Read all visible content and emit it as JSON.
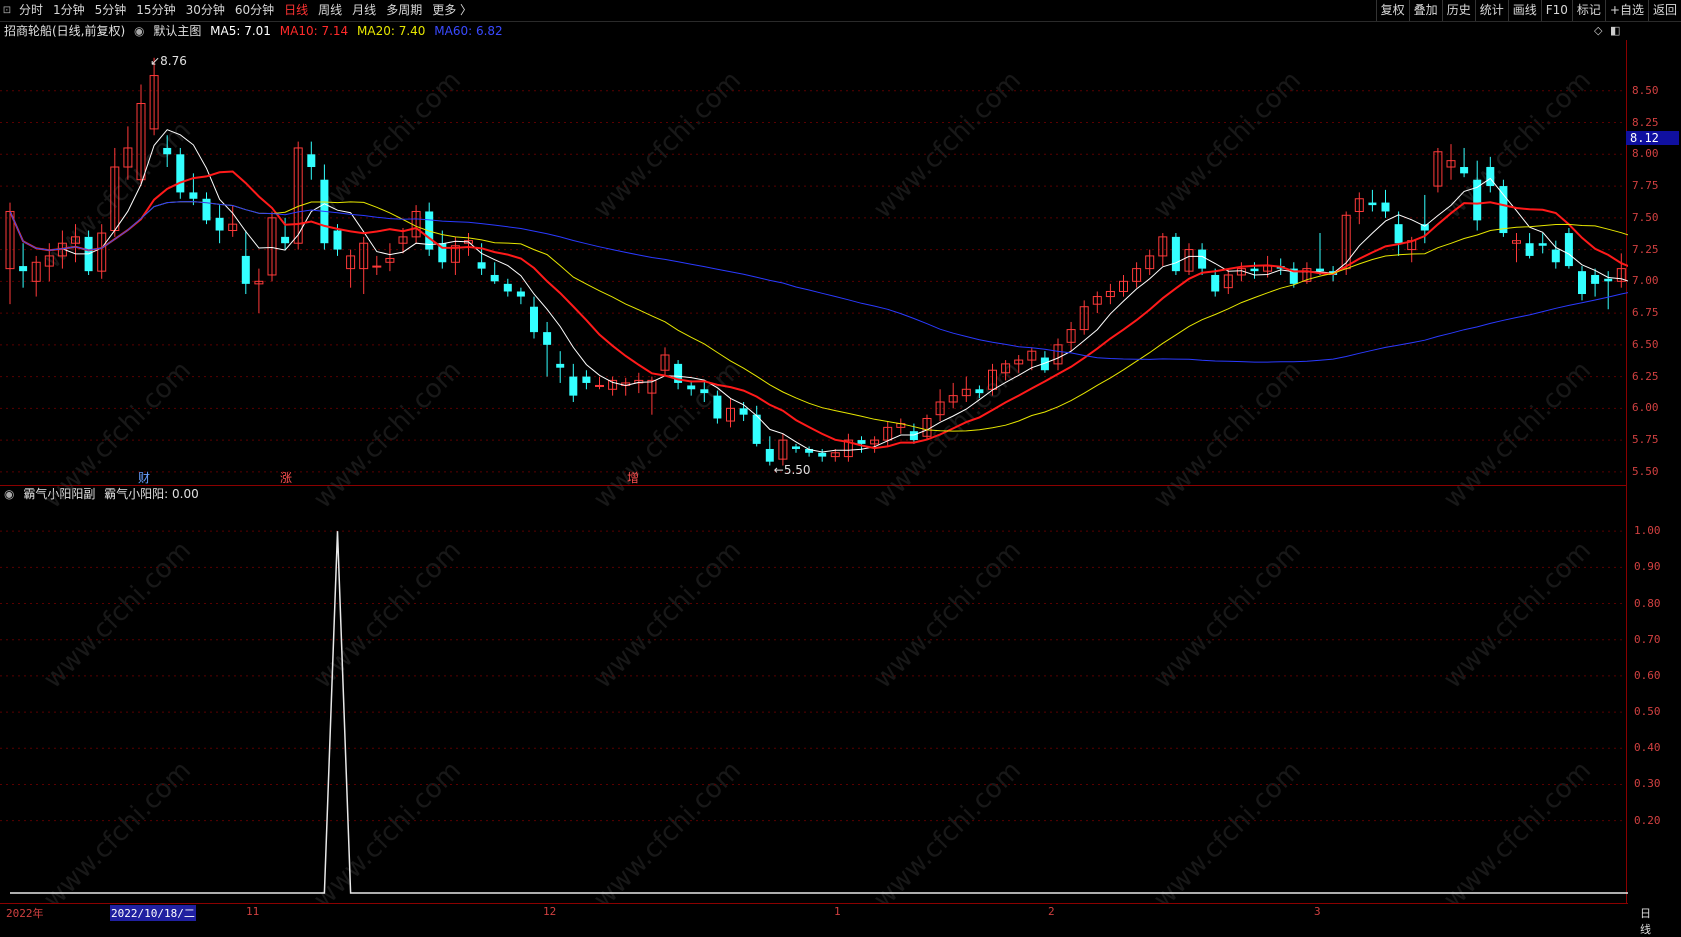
{
  "toolbar": {
    "left_items": [
      "分时",
      "1分钟",
      "5分钟",
      "15分钟",
      "30分钟",
      "60分钟",
      "日线",
      "周线",
      "月线",
      "多周期",
      "更多 〉"
    ],
    "active_item": "日线",
    "right_items": [
      "复权",
      "叠加",
      "历史",
      "统计",
      "画线",
      "F10",
      "标记",
      "+自选",
      "返回"
    ]
  },
  "main_info": {
    "stock": "招商轮船(日线,前复权)",
    "template": "默认主图",
    "ma5": "MA5: 7.01",
    "ma10": "MA10: 7.14",
    "ma20": "MA20: 7.40",
    "ma60": "MA60: 6.82"
  },
  "sub_info": {
    "indicator": "霸气小阳阳副",
    "value": "霸气小阳阳: 0.00"
  },
  "colors": {
    "up": "#ff3a3a",
    "down": "#33ffff",
    "ma5": "#ffffff",
    "ma10": "#ff1a1a",
    "ma20": "#e6e600",
    "ma60": "#2a3aff",
    "border": "#8b0000"
  },
  "price_axis": [
    "8.50",
    "8.25",
    "8.00",
    "7.75",
    "7.50",
    "7.25",
    "7.00",
    "6.75",
    "6.50",
    "6.25",
    "6.00",
    "5.75",
    "5.50"
  ],
  "current_price": "8.12",
  "annotations": {
    "high": "8.76",
    "low": "←5.50",
    "high_arrow": "↙"
  },
  "events": [
    {
      "label": "财",
      "color": "#6aa0ff"
    },
    {
      "label": "涨",
      "color": "#ff5050"
    },
    {
      "label": "增",
      "color": "#ff5050"
    }
  ],
  "sub_axis": [
    "1.00",
    "0.90",
    "0.80",
    "0.70",
    "0.60",
    "0.50",
    "0.40",
    "0.30",
    "0.20"
  ],
  "date_axis": {
    "labels": [
      "2022年",
      "11",
      "12",
      "1",
      "2",
      "3"
    ],
    "selected": "2022/10/18/二",
    "period": "日线"
  },
  "watermark": "www.cfchi.com",
  "chart_data": {
    "type": "candlestick",
    "title": "招商轮船(日线,前复权)",
    "ylim": [
      5.42,
      8.9
    ],
    "candles": [
      [
        7.1,
        7.62,
        6.82,
        7.55
      ],
      [
        7.12,
        7.3,
        6.95,
        7.08
      ],
      [
        7.0,
        7.2,
        6.88,
        7.15
      ],
      [
        7.12,
        7.3,
        7.0,
        7.2
      ],
      [
        7.2,
        7.4,
        7.1,
        7.3
      ],
      [
        7.3,
        7.45,
        7.15,
        7.35
      ],
      [
        7.35,
        7.4,
        7.05,
        7.08
      ],
      [
        7.08,
        7.45,
        7.02,
        7.38
      ],
      [
        7.4,
        8.05,
        7.35,
        7.9
      ],
      [
        7.9,
        8.22,
        7.8,
        8.05
      ],
      [
        7.8,
        8.55,
        7.75,
        8.4
      ],
      [
        8.2,
        8.76,
        8.15,
        8.62
      ],
      [
        8.05,
        8.15,
        7.9,
        8.0
      ],
      [
        8.0,
        8.05,
        7.65,
        7.7
      ],
      [
        7.7,
        7.85,
        7.6,
        7.65
      ],
      [
        7.65,
        7.7,
        7.45,
        7.48
      ],
      [
        7.5,
        7.6,
        7.3,
        7.4
      ],
      [
        7.4,
        7.6,
        7.35,
        7.45
      ],
      [
        7.2,
        7.4,
        6.9,
        6.98
      ],
      [
        6.98,
        7.1,
        6.75,
        7.0
      ],
      [
        7.05,
        7.55,
        7.0,
        7.5
      ],
      [
        7.35,
        7.5,
        7.25,
        7.3
      ],
      [
        7.3,
        8.1,
        7.25,
        8.05
      ],
      [
        8.0,
        8.1,
        7.8,
        7.9
      ],
      [
        7.8,
        7.92,
        7.25,
        7.3
      ],
      [
        7.4,
        7.45,
        7.2,
        7.25
      ],
      [
        7.1,
        7.25,
        6.95,
        7.2
      ],
      [
        7.1,
        7.35,
        6.9,
        7.3
      ],
      [
        7.12,
        7.2,
        7.05,
        7.12
      ],
      [
        7.15,
        7.3,
        7.08,
        7.18
      ],
      [
        7.3,
        7.42,
        7.22,
        7.35
      ],
      [
        7.35,
        7.6,
        7.3,
        7.55
      ],
      [
        7.55,
        7.62,
        7.2,
        7.25
      ],
      [
        7.3,
        7.4,
        7.1,
        7.15
      ],
      [
        7.15,
        7.35,
        7.05,
        7.28
      ],
      [
        7.3,
        7.38,
        7.2,
        7.32
      ],
      [
        7.15,
        7.3,
        7.05,
        7.1
      ],
      [
        7.05,
        7.15,
        6.98,
        7.0
      ],
      [
        6.98,
        7.02,
        6.88,
        6.92
      ],
      [
        6.92,
        6.95,
        6.82,
        6.88
      ],
      [
        6.8,
        6.88,
        6.55,
        6.6
      ],
      [
        6.6,
        6.68,
        6.25,
        6.5
      ],
      [
        6.35,
        6.45,
        6.2,
        6.32
      ],
      [
        6.25,
        6.35,
        6.05,
        6.1
      ],
      [
        6.25,
        6.3,
        6.15,
        6.2
      ],
      [
        6.18,
        6.25,
        6.15,
        6.18
      ],
      [
        6.15,
        6.25,
        6.1,
        6.22
      ],
      [
        6.18,
        6.24,
        6.1,
        6.2
      ],
      [
        6.2,
        6.28,
        6.12,
        6.22
      ],
      [
        6.12,
        6.25,
        5.95,
        6.22
      ],
      [
        6.3,
        6.48,
        6.25,
        6.42
      ],
      [
        6.35,
        6.38,
        6.15,
        6.2
      ],
      [
        6.18,
        6.22,
        6.1,
        6.15
      ],
      [
        6.15,
        6.22,
        6.05,
        6.12
      ],
      [
        6.1,
        6.14,
        5.88,
        5.92
      ],
      [
        5.9,
        6.08,
        5.85,
        6.0
      ],
      [
        6.0,
        6.05,
        5.9,
        5.95
      ],
      [
        5.95,
        6.02,
        5.7,
        5.72
      ],
      [
        5.68,
        5.78,
        5.55,
        5.58
      ],
      [
        5.6,
        5.8,
        5.55,
        5.75
      ],
      [
        5.7,
        5.72,
        5.65,
        5.68
      ],
      [
        5.68,
        5.7,
        5.62,
        5.65
      ],
      [
        5.65,
        5.68,
        5.58,
        5.62
      ],
      [
        5.62,
        5.68,
        5.58,
        5.65
      ],
      [
        5.62,
        5.8,
        5.58,
        5.75
      ],
      [
        5.75,
        5.78,
        5.65,
        5.72
      ],
      [
        5.72,
        5.78,
        5.65,
        5.75
      ],
      [
        5.75,
        5.9,
        5.7,
        5.85
      ],
      [
        5.85,
        5.92,
        5.8,
        5.88
      ],
      [
        5.82,
        5.88,
        5.72,
        5.75
      ],
      [
        5.78,
        5.95,
        5.75,
        5.92
      ],
      [
        5.95,
        6.15,
        5.9,
        6.05
      ],
      [
        6.05,
        6.2,
        6.0,
        6.1
      ],
      [
        6.1,
        6.25,
        6.05,
        6.15
      ],
      [
        6.15,
        6.18,
        6.08,
        6.12
      ],
      [
        6.15,
        6.35,
        6.1,
        6.3
      ],
      [
        6.28,
        6.38,
        6.22,
        6.35
      ],
      [
        6.35,
        6.42,
        6.28,
        6.38
      ],
      [
        6.38,
        6.48,
        6.3,
        6.45
      ],
      [
        6.4,
        6.45,
        6.28,
        6.3
      ],
      [
        6.35,
        6.55,
        6.3,
        6.5
      ],
      [
        6.52,
        6.68,
        6.45,
        6.62
      ],
      [
        6.62,
        6.85,
        6.58,
        6.8
      ],
      [
        6.82,
        6.92,
        6.75,
        6.88
      ],
      [
        6.88,
        6.98,
        6.82,
        6.92
      ],
      [
        6.92,
        7.05,
        6.88,
        7.0
      ],
      [
        7.0,
        7.15,
        6.95,
        7.1
      ],
      [
        7.1,
        7.25,
        7.05,
        7.2
      ],
      [
        7.2,
        7.38,
        7.12,
        7.35
      ],
      [
        7.35,
        7.38,
        7.05,
        7.08
      ],
      [
        7.08,
        7.3,
        7.05,
        7.25
      ],
      [
        7.25,
        7.3,
        7.05,
        7.1
      ],
      [
        7.05,
        7.1,
        6.88,
        6.92
      ],
      [
        6.95,
        7.1,
        6.9,
        7.05
      ],
      [
        7.05,
        7.15,
        7.0,
        7.1
      ],
      [
        7.1,
        7.15,
        7.02,
        7.08
      ],
      [
        7.08,
        7.2,
        7.03,
        7.12
      ],
      [
        7.12,
        7.18,
        7.05,
        7.1
      ],
      [
        7.1,
        7.15,
        6.95,
        6.98
      ],
      [
        7.0,
        7.15,
        6.98,
        7.1
      ],
      [
        7.1,
        7.38,
        7.05,
        7.08
      ],
      [
        7.08,
        7.12,
        7.0,
        7.05
      ],
      [
        7.1,
        7.55,
        7.05,
        7.52
      ],
      [
        7.55,
        7.7,
        7.45,
        7.65
      ],
      [
        7.62,
        7.72,
        7.55,
        7.6
      ],
      [
        7.62,
        7.72,
        7.5,
        7.55
      ],
      [
        7.45,
        7.55,
        7.2,
        7.3
      ],
      [
        7.25,
        7.35,
        7.15,
        7.32
      ],
      [
        7.45,
        7.68,
        7.3,
        7.4
      ],
      [
        7.75,
        8.05,
        7.7,
        8.02
      ],
      [
        7.9,
        8.08,
        7.8,
        7.95
      ],
      [
        7.9,
        8.05,
        7.82,
        7.85
      ],
      [
        7.8,
        7.95,
        7.4,
        7.48
      ],
      [
        7.9,
        7.98,
        7.7,
        7.75
      ],
      [
        7.75,
        7.8,
        7.35,
        7.38
      ],
      [
        7.3,
        7.38,
        7.15,
        7.32
      ],
      [
        7.3,
        7.38,
        7.18,
        7.2
      ],
      [
        7.3,
        7.38,
        7.22,
        7.28
      ],
      [
        7.25,
        7.32,
        7.1,
        7.15
      ],
      [
        7.38,
        7.42,
        7.1,
        7.12
      ],
      [
        7.08,
        7.12,
        6.85,
        6.9
      ],
      [
        7.05,
        7.1,
        6.88,
        6.98
      ],
      [
        7.02,
        7.08,
        6.78,
        7.0
      ],
      [
        7.0,
        7.22,
        6.95,
        7.1
      ],
      [
        6.98,
        7.05,
        6.9,
        6.95
      ]
    ],
    "ma_series": [
      {
        "name": "MA5",
        "period": 5
      },
      {
        "name": "MA10",
        "period": 10
      },
      {
        "name": "MA20",
        "period": 20
      },
      {
        "name": "MA60",
        "period": 60
      }
    ],
    "indicator": {
      "name": "霸气小阳阳",
      "values_all_zero_except": [
        {
          "index": 25,
          "value": 1.0
        }
      ],
      "ylim": [
        0,
        1.1
      ]
    }
  }
}
